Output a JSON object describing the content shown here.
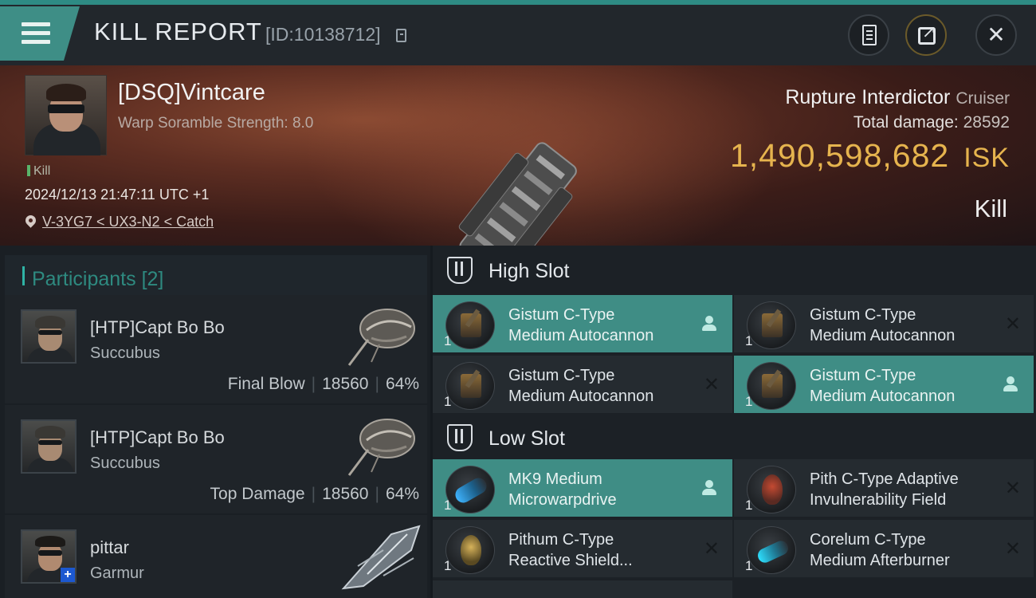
{
  "header": {
    "title": "KILL REPORT",
    "report_id": "[ID:10138712]",
    "icons": [
      "menu-icon",
      "copy-icon",
      "notes-icon",
      "share-icon",
      "close-icon"
    ]
  },
  "victim": {
    "name": "[DSQ]Vintcare",
    "scramble": "Warp Soramble Strength: 8.0",
    "tag": "Kill",
    "timestamp": "2024/12/13 21:47:11 UTC +1",
    "location": "V-3YG7 < UX3-N2 < Catch",
    "ship_name": "Rupture Interdictor",
    "ship_class": "Cruiser",
    "damage_label": "Total damage:",
    "damage_value": "28592",
    "isk_value": "1,490,598,682",
    "isk_unit": "ISK",
    "result": "Kill"
  },
  "participants": {
    "label": "Participants",
    "count": "[2]",
    "items": [
      {
        "name": "[HTP]Capt Bo Bo",
        "ship": "Succubus",
        "role": "Final Blow",
        "damage": "18560",
        "percent": "64%"
      },
      {
        "name": "[HTP]Capt Bo Bo",
        "ship": "Succubus",
        "role": "Top Damage",
        "damage": "18560",
        "percent": "64%"
      },
      {
        "name": "pittar",
        "ship": "Garmur"
      }
    ]
  },
  "slots": {
    "high": {
      "label": "High Slot",
      "modules": [
        {
          "line1": "Gistum C-Type",
          "line2": "Medium Autocannon",
          "qty": "1"
        },
        {
          "line1": "Gistum C-Type",
          "line2": "Medium Autocannon",
          "qty": "1"
        },
        {
          "line1": "Gistum C-Type",
          "line2": "Medium Autocannon",
          "qty": "1"
        },
        {
          "line1": "Gistum C-Type",
          "line2": "Medium Autocannon",
          "qty": "1"
        }
      ]
    },
    "low": {
      "label": "Low Slot",
      "modules": [
        {
          "line1": "MK9 Medium",
          "line2": "Microwarpdrive",
          "qty": "1"
        },
        {
          "line1": "Pith C-Type Adaptive",
          "line2": "Invulnerability Field",
          "qty": "1"
        },
        {
          "line1": "Pithum C-Type",
          "line2": "Reactive Shield...",
          "qty": "1"
        },
        {
          "line1": "Corelum C-Type",
          "line2": "Medium Afterburner",
          "qty": "1"
        }
      ]
    }
  },
  "colors": {
    "accent": "#3f8d85",
    "isk": "#e6b44e",
    "background": "#151a1f"
  }
}
